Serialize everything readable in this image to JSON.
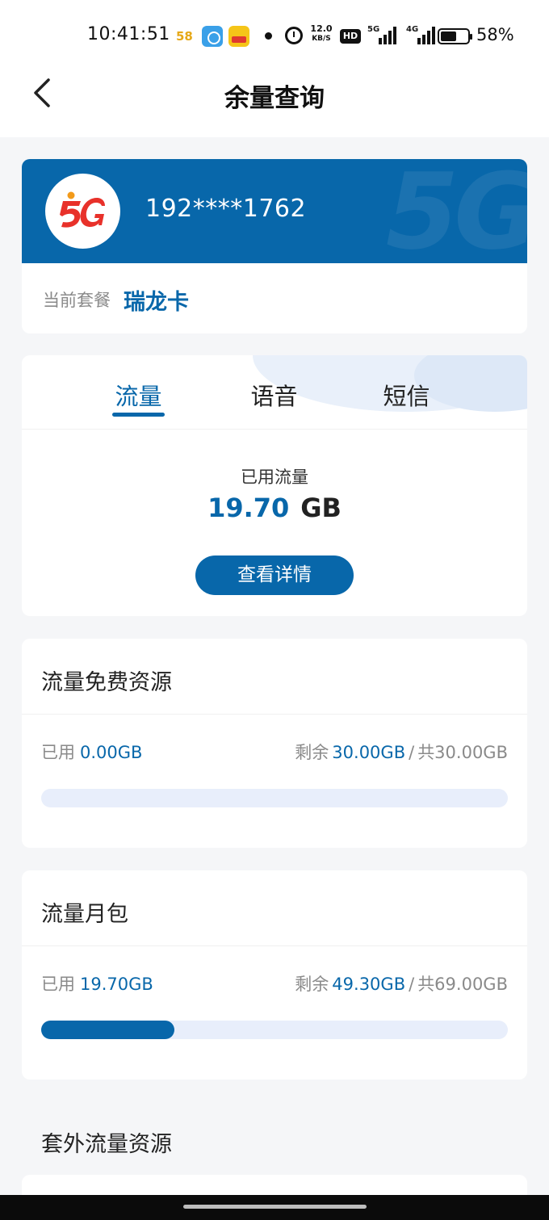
{
  "status_bar": {
    "time": "10:41:51",
    "app_58": "58",
    "net_speed_value": "12.0",
    "net_speed_unit": "KB/S",
    "hd_label": "HD",
    "signal1_label": "5G",
    "signal2_label": "4G",
    "battery_percent": "58%",
    "battery_level": 0.58
  },
  "header": {
    "title": "余量查询",
    "back_icon": "chevron-left-icon"
  },
  "account": {
    "logo_text": "5G",
    "watermark_text": "5G",
    "phone": "192****1762",
    "plan_label": "当前套餐",
    "plan_name": "瑞龙卡"
  },
  "tabs": {
    "items": [
      {
        "label": "流量",
        "active": true
      },
      {
        "label": "语音",
        "active": false
      },
      {
        "label": "短信",
        "active": false
      }
    ],
    "used_label": "已用流量",
    "used_value": "19.70",
    "used_unit": "GB",
    "detail_button": "查看详情"
  },
  "resources": [
    {
      "title": "流量免费资源",
      "used_label": "已用",
      "used_value": "0.00GB",
      "remain_label": "剩余",
      "remain_value": "30.00GB",
      "separator": "/",
      "total": "共30.00GB",
      "used_fraction": 0.0
    },
    {
      "title": "流量月包",
      "used_label": "已用",
      "used_value": "19.70GB",
      "remain_label": "剩余",
      "remain_value": "49.30GB",
      "separator": "/",
      "total": "共69.00GB",
      "used_fraction": 0.2855
    }
  ],
  "extra_section": {
    "title": "套外流量资源"
  },
  "colors": {
    "brand_blue": "#0867aa",
    "track": "#e8eefb",
    "background": "#f5f6f8",
    "logo_red": "#e8312a",
    "logo_orange": "#f29a1a"
  }
}
